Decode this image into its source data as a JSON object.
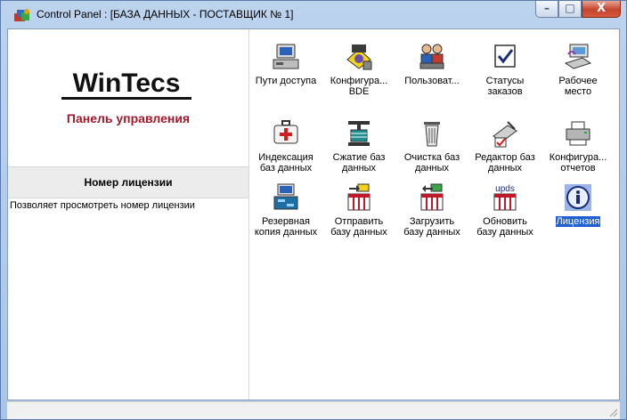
{
  "window": {
    "title": "Control Panel : [БАЗА ДАННЫХ - ПОСТАВЩИК № 1]",
    "minimize_glyph": "–",
    "maximize_glyph": "□",
    "close_glyph": "X"
  },
  "left_panel": {
    "logo_text": "WinTecs",
    "subtitle": "Панель управления",
    "selected_item_title": "Номер лицензии",
    "selected_item_description": "Позволяет просмотреть номер лицензии"
  },
  "applets": [
    {
      "label_lines": [
        "Пути доступа"
      ],
      "icon": "computer-icon"
    },
    {
      "label_lines": [
        "Конфигура...",
        "BDE"
      ],
      "icon": "bde-config-icon"
    },
    {
      "label_lines": [
        "Пользоват..."
      ],
      "icon": "users-icon"
    },
    {
      "label_lines": [
        "Статусы",
        "заказов"
      ],
      "icon": "checkbox-icon"
    },
    {
      "label_lines": [
        "Рабочее",
        "место"
      ],
      "icon": "workplace-icon"
    },
    {
      "label_lines": [
        "Индексация",
        "баз данных"
      ],
      "icon": "medical-kit-icon"
    },
    {
      "label_lines": [
        "Сжатие баз",
        "данных"
      ],
      "icon": "compress-icon"
    },
    {
      "label_lines": [
        "Очистка баз",
        "данных"
      ],
      "icon": "trash-icon"
    },
    {
      "label_lines": [
        "Редактор баз",
        "данных"
      ],
      "icon": "db-editor-icon"
    },
    {
      "label_lines": [
        "Конфигура...",
        "отчетов"
      ],
      "icon": "printer-icon"
    },
    {
      "label_lines": [
        "Резервная",
        "копия данных"
      ],
      "icon": "backup-icon"
    },
    {
      "label_lines": [
        "Отправить",
        "базу данных"
      ],
      "icon": "send-db-icon"
    },
    {
      "label_lines": [
        "Загрузить",
        "базу данных"
      ],
      "icon": "load-db-icon"
    },
    {
      "label_lines": [
        "Обновить",
        "базу данных"
      ],
      "icon": "update-db-icon",
      "icon_text": "upds"
    },
    {
      "label_lines": [
        "Лицензия"
      ],
      "icon": "info-icon",
      "selected": true
    }
  ],
  "colors": {
    "brand_red": "#a5182a",
    "selection_blue": "#1f5fd1",
    "panel_gray": "#ececec"
  }
}
